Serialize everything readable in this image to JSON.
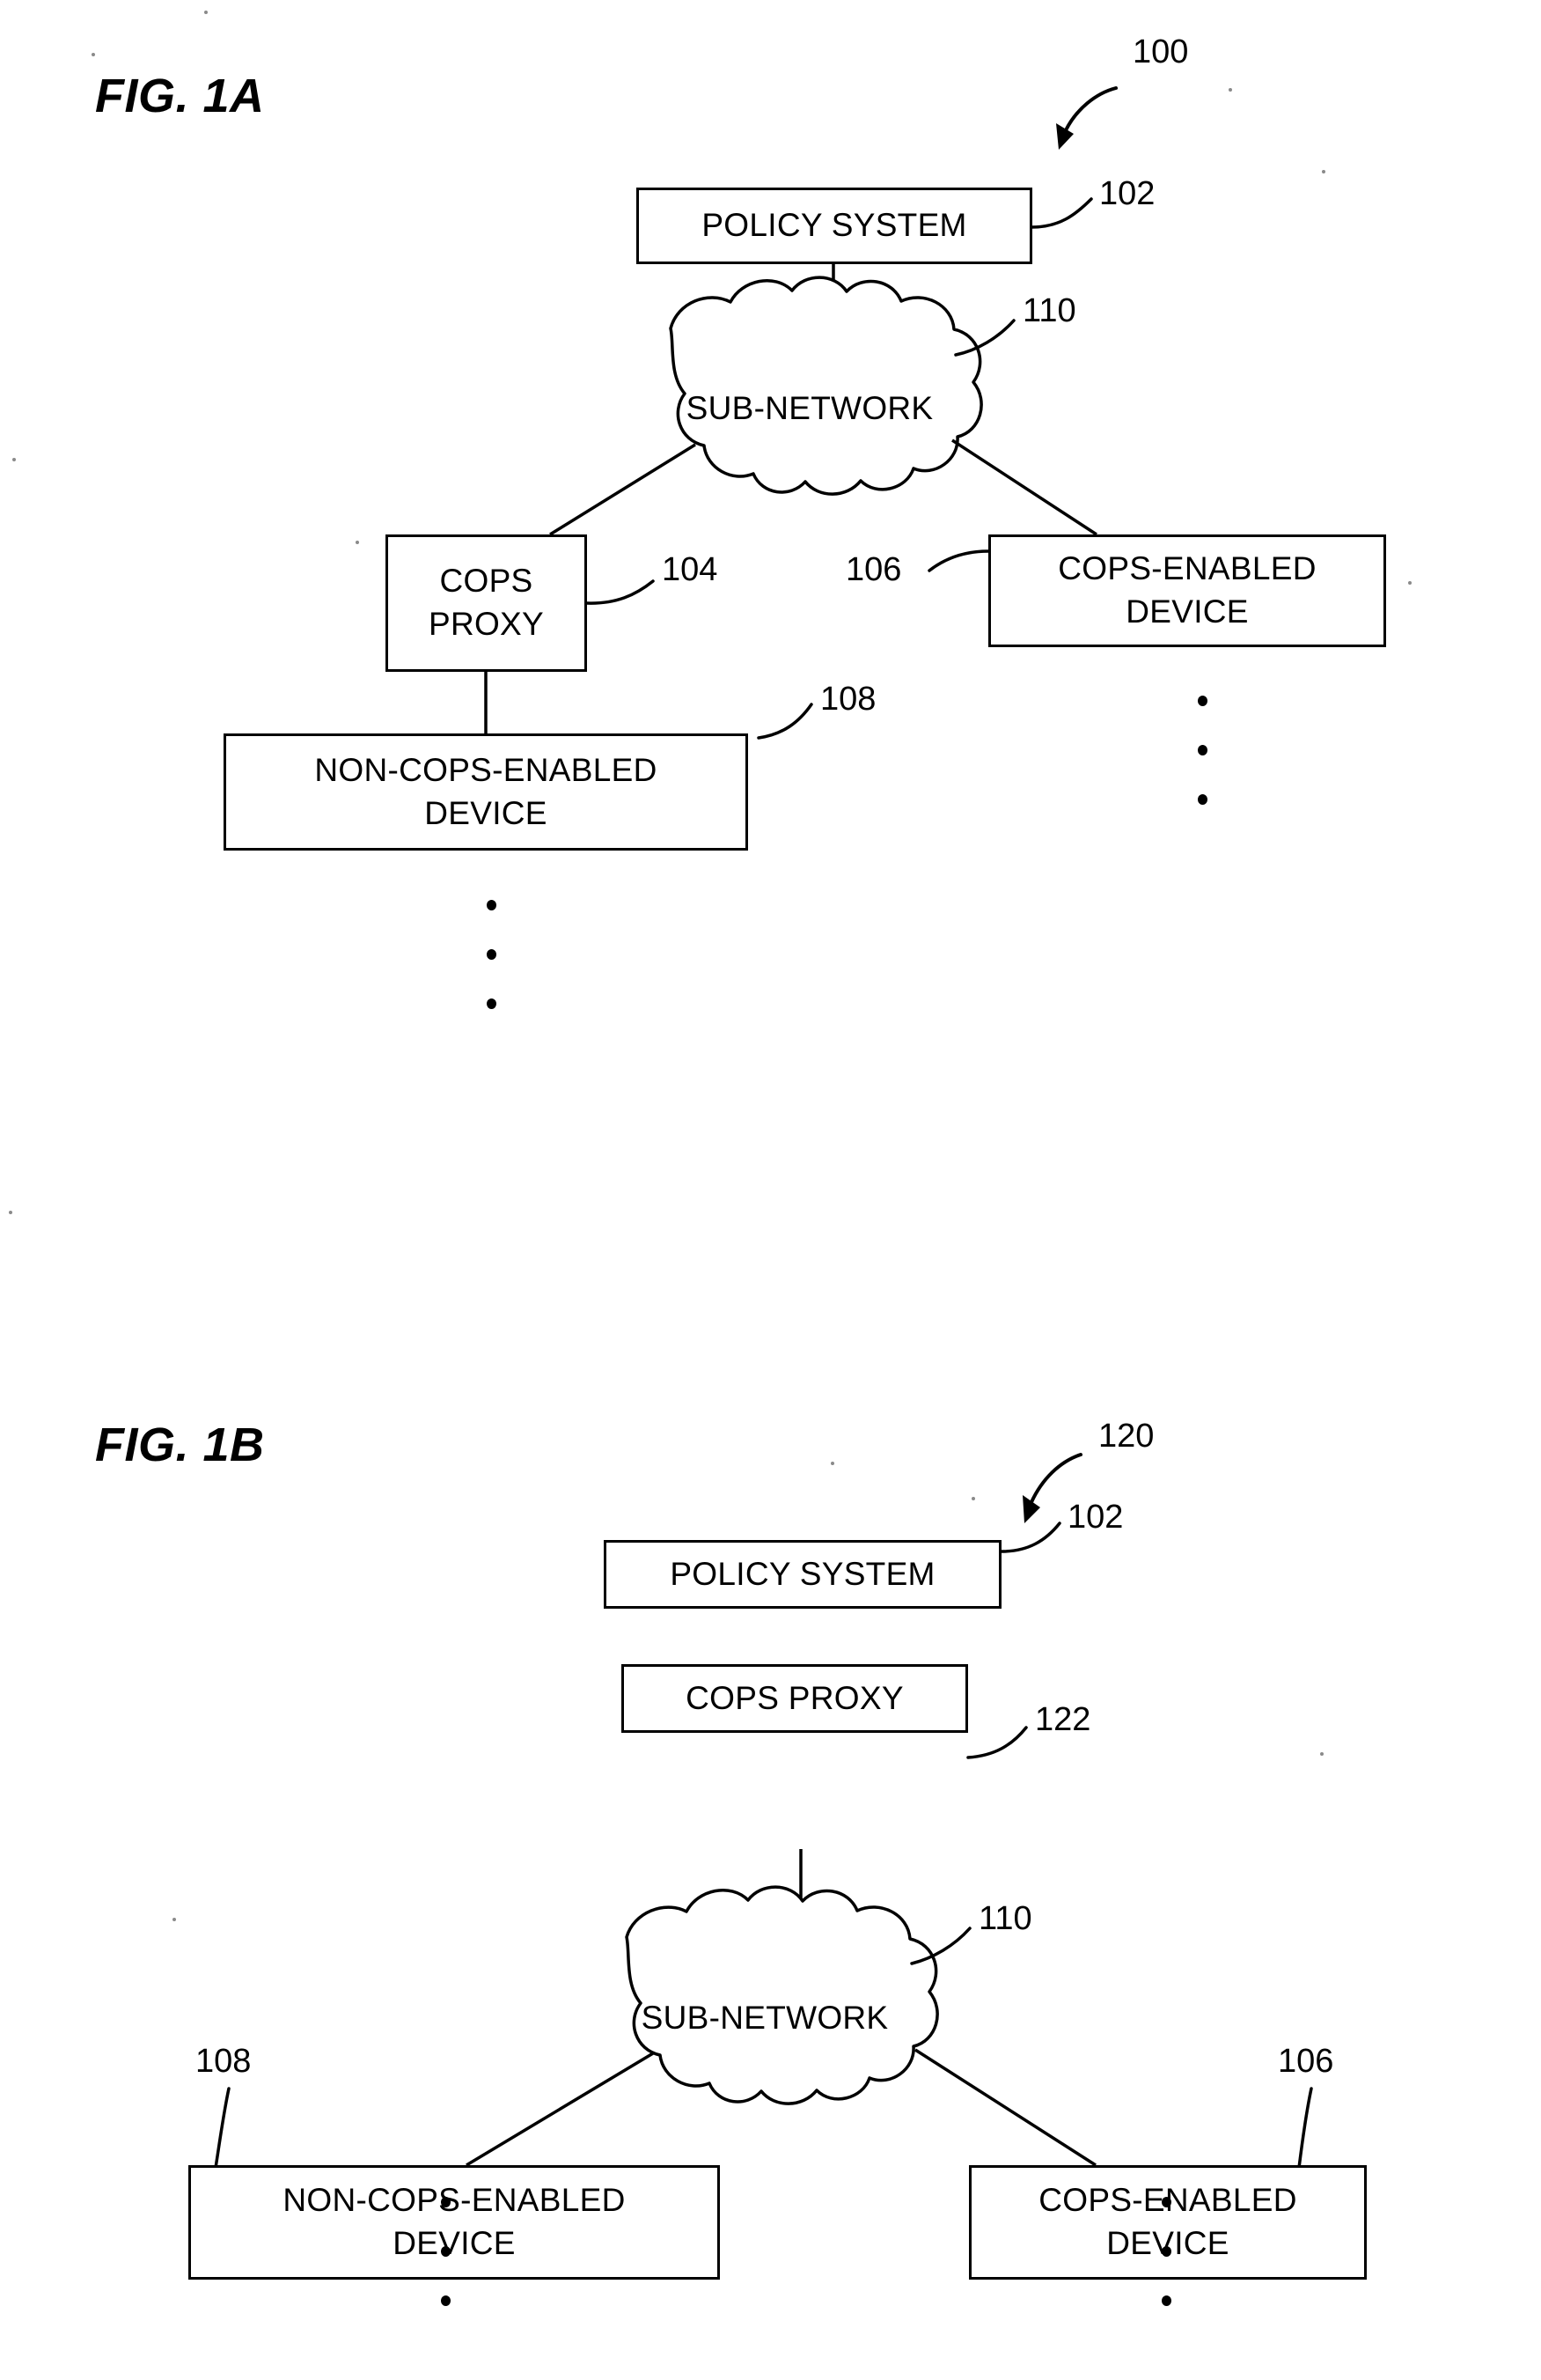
{
  "document": {
    "type": "patent-figure-sheet",
    "figures": [
      {
        "id": "fig-1a",
        "caption": "FIG. 1A",
        "system_ref": "100",
        "nodes": [
          {
            "key": "policy_system",
            "label_lines": [
              "POLICY SYSTEM"
            ],
            "ref": "102",
            "shape": "box"
          },
          {
            "key": "sub_network",
            "label_lines": [
              "SUB-NETWORK"
            ],
            "ref": "110",
            "shape": "cloud"
          },
          {
            "key": "cops_proxy",
            "label_lines": [
              "COPS",
              "PROXY"
            ],
            "ref": "104",
            "shape": "box"
          },
          {
            "key": "cops_enabled_device",
            "label_lines": [
              "COPS-ENABLED",
              "DEVICE"
            ],
            "ref": "106",
            "shape": "box"
          },
          {
            "key": "non_cops_enabled_device",
            "label_lines": [
              "NON-COPS-ENABLED",
              "DEVICE"
            ],
            "ref": "108",
            "shape": "box"
          }
        ],
        "connections": [
          {
            "from": "policy_system",
            "to": "sub_network"
          },
          {
            "from": "sub_network",
            "to": "cops_proxy"
          },
          {
            "from": "sub_network",
            "to": "cops_enabled_device"
          },
          {
            "from": "cops_proxy",
            "to": "non_cops_enabled_device"
          }
        ],
        "ellipses": [
          {
            "key": "ellipsis-below-cops-enabled-device",
            "count": 3
          },
          {
            "key": "ellipsis-below-non-cops-enabled-device",
            "count": 3
          }
        ]
      },
      {
        "id": "fig-1b",
        "caption": "FIG. 1B",
        "system_ref": "120",
        "nodes": [
          {
            "key": "policy_system",
            "label_lines": [
              "POLICY SYSTEM"
            ],
            "ref": "102",
            "shape": "box"
          },
          {
            "key": "cops_proxy",
            "label_lines": [
              "COPS PROXY"
            ],
            "ref": "122",
            "shape": "box"
          },
          {
            "key": "sub_network",
            "label_lines": [
              "SUB-NETWORK"
            ],
            "ref": "110",
            "shape": "cloud"
          },
          {
            "key": "non_cops_enabled_device",
            "label_lines": [
              "NON-COPS-ENABLED",
              "DEVICE"
            ],
            "ref": "108",
            "shape": "box"
          },
          {
            "key": "cops_enabled_device",
            "label_lines": [
              "COPS-ENABLED",
              "DEVICE"
            ],
            "ref": "106",
            "shape": "box"
          }
        ],
        "connections": [
          {
            "from": "policy_system",
            "to": "cops_proxy"
          },
          {
            "from": "cops_proxy",
            "to": "sub_network"
          },
          {
            "from": "sub_network",
            "to": "non_cops_enabled_device"
          },
          {
            "from": "sub_network",
            "to": "cops_enabled_device"
          }
        ],
        "ellipses": [
          {
            "key": "ellipsis-below-non-cops-enabled-device",
            "count": 3
          },
          {
            "key": "ellipsis-below-cops-enabled-device",
            "count": 3
          }
        ]
      }
    ]
  },
  "fig1a": {
    "caption": "FIG. 1A",
    "ref_100": "100",
    "ref_102": "102",
    "ref_110": "110",
    "ref_104": "104",
    "ref_106": "106",
    "ref_108": "108",
    "policy_system": "POLICY SYSTEM",
    "sub_network": "SUB-NETWORK",
    "cops_proxy_l1": "COPS",
    "cops_proxy_l2": "PROXY",
    "cops_enabled_l1": "COPS-ENABLED",
    "cops_enabled_l2": "DEVICE",
    "non_cops_l1": "NON-COPS-ENABLED",
    "non_cops_l2": "DEVICE"
  },
  "fig1b": {
    "caption": "FIG. 1B",
    "ref_120": "120",
    "ref_102": "102",
    "ref_122": "122",
    "ref_110": "110",
    "ref_108": "108",
    "ref_106": "106",
    "policy_system": "POLICY SYSTEM",
    "cops_proxy": "COPS PROXY",
    "sub_network": "SUB-NETWORK",
    "non_cops_l1": "NON-COPS-ENABLED",
    "non_cops_l2": "DEVICE",
    "cops_enabled_l1": "COPS-ENABLED",
    "cops_enabled_l2": "DEVICE"
  },
  "colors": {
    "ink": "#000000",
    "paper": "#ffffff"
  }
}
